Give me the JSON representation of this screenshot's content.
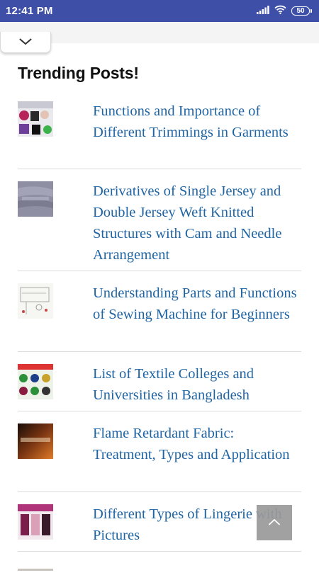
{
  "status_bar": {
    "time": "12:41 PM",
    "battery_level": "50",
    "icons": [
      "signal-icon",
      "wifi-icon",
      "battery-icon"
    ]
  },
  "collapse_toggle": {
    "icon": "chevron-down-icon"
  },
  "trending": {
    "title": "Trending Posts!",
    "posts": [
      {
        "title": "Functions and Importance of Different Trimmings in Garments",
        "thumb_icon": "thumbnail-image"
      },
      {
        "title": "Derivatives of Single Jersey and Double Jersey Weft Knitted Structures with Cam and Needle Arrangement",
        "thumb_icon": "thumbnail-image"
      },
      {
        "title": "Understanding Parts and Functions of Sewing Machine for Beginners",
        "thumb_icon": "thumbnail-image"
      },
      {
        "title": "List of Textile Colleges and Universities in Bangladesh",
        "thumb_icon": "thumbnail-image"
      },
      {
        "title": "Flame Retardant Fabric: Treatment, Types and Application",
        "thumb_icon": "thumbnail-image"
      },
      {
        "title": "Different Types of Lingerie with Pictures",
        "thumb_icon": "thumbnail-image"
      }
    ]
  },
  "back_to_top": {
    "icon": "chevron-up-icon"
  },
  "colors": {
    "status_bar_bg": "#3e4fa8",
    "link_color": "#1f64a3",
    "title_color": "#111111",
    "back_to_top_bg": "#9a9a9a"
  }
}
